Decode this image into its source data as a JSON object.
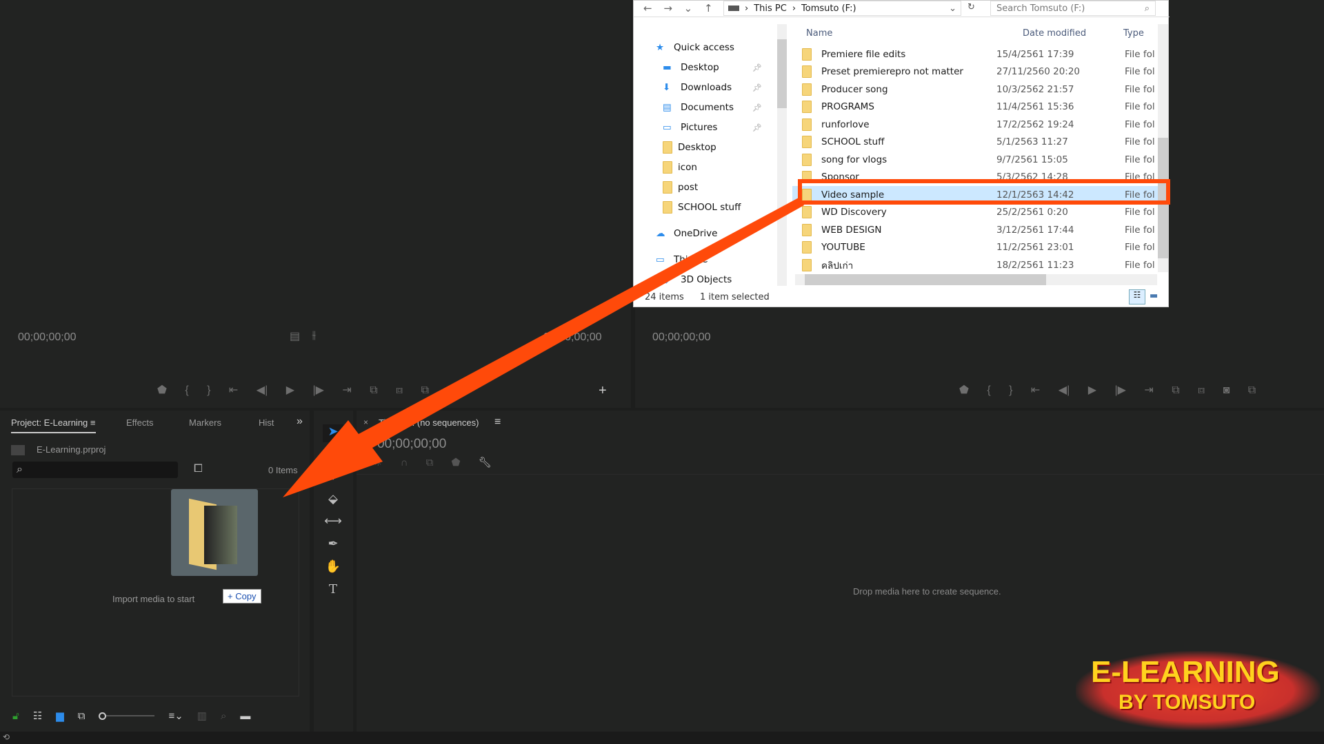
{
  "source_monitor": {
    "timecode_in": "00;00;00;00",
    "timecode_out": "00;00;00;00"
  },
  "program_monitor": {
    "timecode": "00;00;00;00"
  },
  "project_panel": {
    "tabs": [
      "Project: E-Learning",
      "Effects",
      "Markers",
      "Hist"
    ],
    "more": "»",
    "project_file": "E-Learning.prproj",
    "search_placeholder": "",
    "items_count": "0 Items",
    "empty_hint": "Import media to start",
    "drag_badge": "+ Copy"
  },
  "timeline": {
    "tab_close": "×",
    "tab_label": "Timeline: (no sequences)",
    "timecode": "00;00;00;00",
    "drop_hint": "Drop media here to create sequence."
  },
  "explorer": {
    "breadcrumb": [
      "This PC",
      "Tomsuto (F:)"
    ],
    "search_placeholder": "Search Tomsuto (F:)",
    "nav": [
      {
        "label": "Quick access",
        "icon": "star-icon"
      },
      {
        "label": "Desktop",
        "icon": "desktop-icon",
        "pinned": true
      },
      {
        "label": "Downloads",
        "icon": "download-icon",
        "pinned": true
      },
      {
        "label": "Documents",
        "icon": "documents-icon",
        "pinned": true
      },
      {
        "label": "Pictures",
        "icon": "pictures-icon",
        "pinned": true
      },
      {
        "label": "Desktop",
        "icon": "folder-icon"
      },
      {
        "label": "icon",
        "icon": "folder-icon"
      },
      {
        "label": "post",
        "icon": "folder-icon"
      },
      {
        "label": "SCHOOL stuff",
        "icon": "folder-icon"
      },
      {
        "label": "OneDrive",
        "icon": "cloud-icon"
      },
      {
        "label": "This PC",
        "icon": "pc-icon"
      },
      {
        "label": "3D Objects",
        "icon": "cube-icon"
      }
    ],
    "columns": [
      "Name",
      "Date modified",
      "Type"
    ],
    "files": [
      {
        "name": "Premiere file edits",
        "date": "15/4/2561 17:39",
        "type": "File fol"
      },
      {
        "name": "Preset premierepro not matter",
        "date": "27/11/2560 20:20",
        "type": "File fol"
      },
      {
        "name": "Producer song",
        "date": "10/3/2562 21:57",
        "type": "File fol"
      },
      {
        "name": "PROGRAMS",
        "date": "11/4/2561 15:36",
        "type": "File fol"
      },
      {
        "name": "runforlove",
        "date": "17/2/2562 19:24",
        "type": "File fol"
      },
      {
        "name": "SCHOOL stuff",
        "date": "5/1/2563 11:27",
        "type": "File fol"
      },
      {
        "name": "song for vlogs",
        "date": "9/7/2561 15:05",
        "type": "File fol"
      },
      {
        "name": "Sponsor",
        "date": "5/3/2562 14:28",
        "type": "File fol"
      },
      {
        "name": "Video sample",
        "date": "12/1/2563 14:42",
        "type": "File fol",
        "selected": true
      },
      {
        "name": "WD Discovery",
        "date": "25/2/2561 0:20",
        "type": "File fol"
      },
      {
        "name": "WEB DESIGN",
        "date": "3/12/2561 17:44",
        "type": "File fol"
      },
      {
        "name": "YOUTUBE",
        "date": "11/2/2561 23:01",
        "type": "File fol"
      },
      {
        "name": "คลิปเก่า",
        "date": "18/2/2561 11:23",
        "type": "File fol"
      }
    ],
    "status_items": "24 items",
    "status_selected": "1 item selected"
  },
  "watermark": {
    "line1": "E-LEARNING",
    "line2": "BY TOMSUTO"
  },
  "colors": {
    "highlight": "#ff4a0a",
    "selection": "#cce8ff",
    "accent": "#2d8ceb"
  }
}
